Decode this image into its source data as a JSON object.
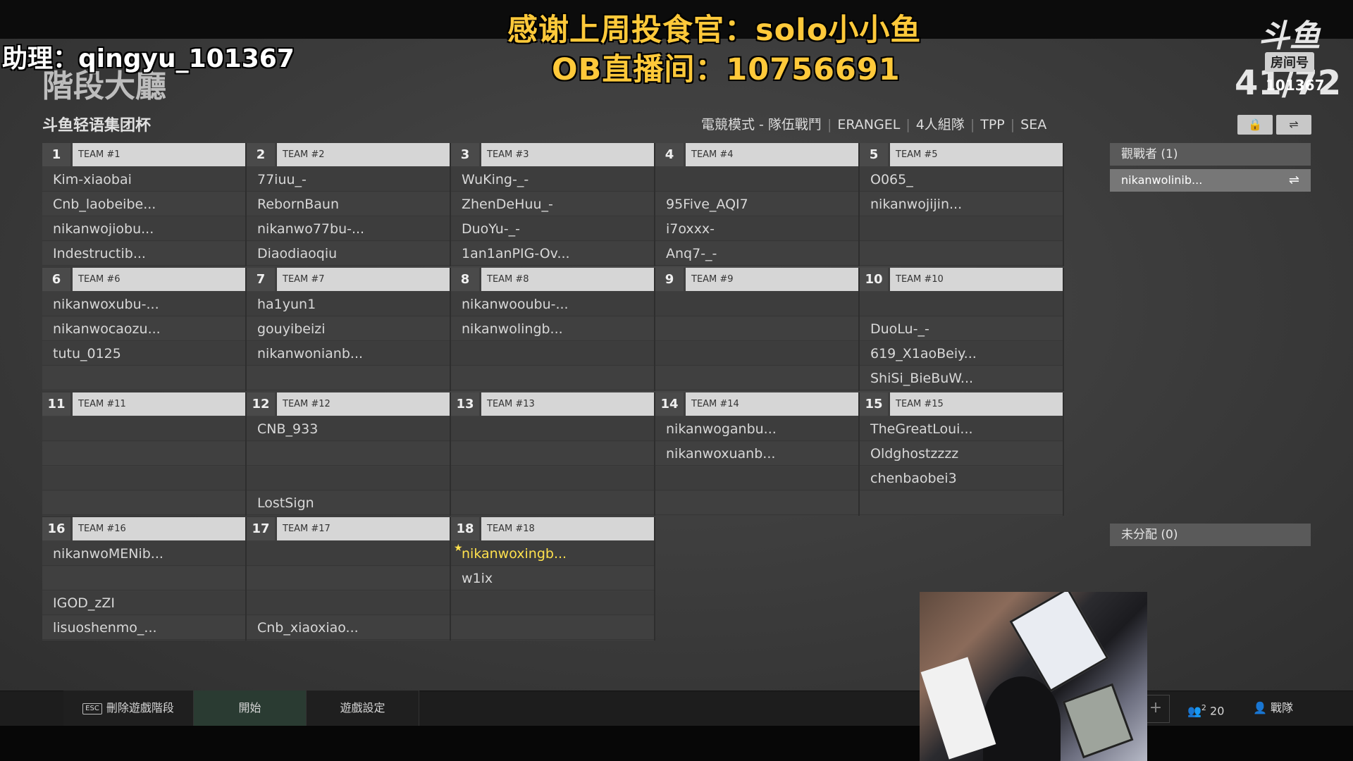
{
  "overlay": {
    "line1": "感谢上周投食官：solo小小鱼",
    "line2": "OB直播间：10756691",
    "assistant": "助理：qingyu_101367"
  },
  "header": {
    "page_title": "階段大廳",
    "player_count": "41/72",
    "logo_mark": "斗鱼",
    "logo_sub": "房间号",
    "room_number": "101367",
    "lobby_name": "斗鱼轻语集团杯",
    "mode": "電競模式 - 隊伍戰鬥",
    "map": "ERANGEL",
    "squad": "4人組隊",
    "perspective": "TPP",
    "region": "SEA",
    "lock_icon": "lock-icon",
    "swap_icon": "swap-icon"
  },
  "teams": [
    {
      "num": "1",
      "name": "TEAM #1",
      "slots": [
        "Kim-xiaobai",
        "Cnb_laobeibe...",
        "nikanwojiobu...",
        "Indestructib..."
      ]
    },
    {
      "num": "2",
      "name": "TEAM #2",
      "slots": [
        "77iuu_-",
        "RebornBaun",
        "nikanwo77bu-...",
        "Diaodiaoqiu"
      ]
    },
    {
      "num": "3",
      "name": "TEAM #3",
      "slots": [
        "WuKing-_-",
        "ZhenDeHuu_-",
        "DuoYu-_-",
        "1an1anPIG-Ov..."
      ]
    },
    {
      "num": "4",
      "name": "TEAM #4",
      "slots": [
        "",
        "95Five_AQI7",
        "i7oxxx-",
        "Anq7-_-"
      ]
    },
    {
      "num": "5",
      "name": "TEAM #5",
      "slots": [
        "O065_",
        "nikanwojijin...",
        "",
        ""
      ]
    },
    {
      "num": "6",
      "name": "TEAM #6",
      "slots": [
        "nikanwoxubu-...",
        "nikanwocaozu...",
        "tutu_0125",
        ""
      ]
    },
    {
      "num": "7",
      "name": "TEAM #7",
      "slots": [
        "ha1yun1",
        "gouyibeizi",
        "nikanwonianb...",
        ""
      ]
    },
    {
      "num": "8",
      "name": "TEAM #8",
      "slots": [
        "nikanwooubu-...",
        "nikanwolingb...",
        "",
        ""
      ]
    },
    {
      "num": "9",
      "name": "TEAM #9",
      "slots": [
        "",
        "",
        "",
        ""
      ]
    },
    {
      "num": "10",
      "name": "TEAM #10",
      "slots": [
        "",
        "DuoLu-_-",
        "619_X1aoBeiy...",
        "ShiSi_BieBuW..."
      ]
    },
    {
      "num": "11",
      "name": "TEAM #11",
      "slots": [
        "",
        "",
        "",
        ""
      ]
    },
    {
      "num": "12",
      "name": "TEAM #12",
      "slots": [
        "CNB_933",
        "",
        "",
        "LostSign"
      ]
    },
    {
      "num": "13",
      "name": "TEAM #13",
      "slots": [
        "",
        "",
        "",
        ""
      ]
    },
    {
      "num": "14",
      "name": "TEAM #14",
      "slots": [
        "nikanwoganbu...",
        "nikanwoxuanb...",
        "",
        ""
      ]
    },
    {
      "num": "15",
      "name": "TEAM #15",
      "slots": [
        "TheGreatLoui...",
        "Oldghostzzzz",
        "chenbaobei3",
        ""
      ]
    },
    {
      "num": "16",
      "name": "TEAM #16",
      "slots": [
        "nikanwoMENib...",
        "",
        "IGOD_zZI",
        "lisuoshenmo_..."
      ]
    },
    {
      "num": "17",
      "name": "TEAM #17",
      "slots": [
        "",
        "",
        "",
        "Cnb_xiaoxiao..."
      ]
    },
    {
      "num": "18",
      "name": "TEAM #18",
      "slots": [
        "nikanwoxingb...",
        "w1ix",
        "",
        ""
      ],
      "highlight_slot": 0
    }
  ],
  "side": {
    "spectators_label": "觀戰者 (1)",
    "spectator": "nikanwolinib...",
    "unassigned_label": "未分配 (0)"
  },
  "bottom": {
    "esc_key": "ESC",
    "delete_label": "刪除遊戲階段",
    "start_label": "開始",
    "settings_label": "遊戲設定",
    "plus": "+",
    "people_count": "20",
    "people_badge": "2",
    "kick_label": "戰隊"
  }
}
